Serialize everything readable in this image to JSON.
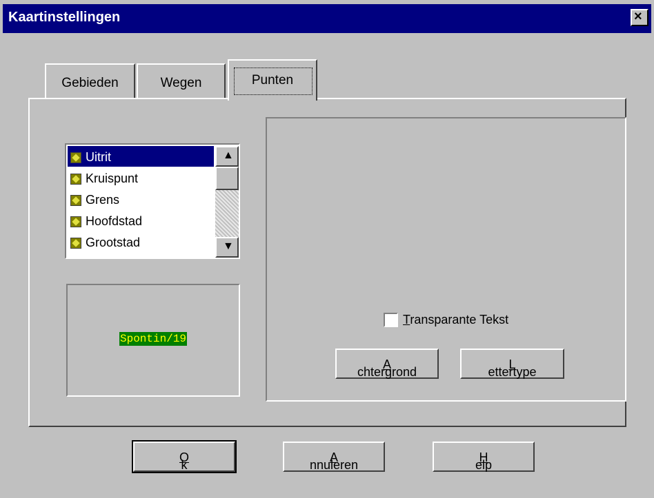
{
  "window": {
    "title": "Kaartinstellingen",
    "close_glyph": "×"
  },
  "tabs": [
    {
      "label": "Gebieden",
      "active": false
    },
    {
      "label": "Wegen",
      "active": false
    },
    {
      "label": "Punten",
      "active": true
    }
  ],
  "list": {
    "items": [
      {
        "label": "Uitrit",
        "selected": true,
        "icon": "point-style-icon"
      },
      {
        "label": "Kruispunt",
        "selected": false,
        "icon": "point-style-icon"
      },
      {
        "label": "Grens",
        "selected": false,
        "icon": "point-style-icon"
      },
      {
        "label": "Hoofdstad",
        "selected": false,
        "icon": "point-style-icon"
      },
      {
        "label": "Grootstad",
        "selected": false,
        "icon": "point-style-icon"
      }
    ]
  },
  "preview": {
    "sample_text": "Spontin/19",
    "sample_bg": "#008000",
    "sample_fg": "#ffff00"
  },
  "options": {
    "transparent_text": {
      "label": "Transparante Tekst",
      "checked": false
    },
    "background_button": "Achtergrond",
    "font_button": "Lettertype"
  },
  "footer": {
    "ok": "Ok",
    "cancel": "Annuleren",
    "help": "Help"
  },
  "colors": {
    "titlebar": "#000080",
    "face": "#c0c0c0",
    "selection": "#000080"
  }
}
